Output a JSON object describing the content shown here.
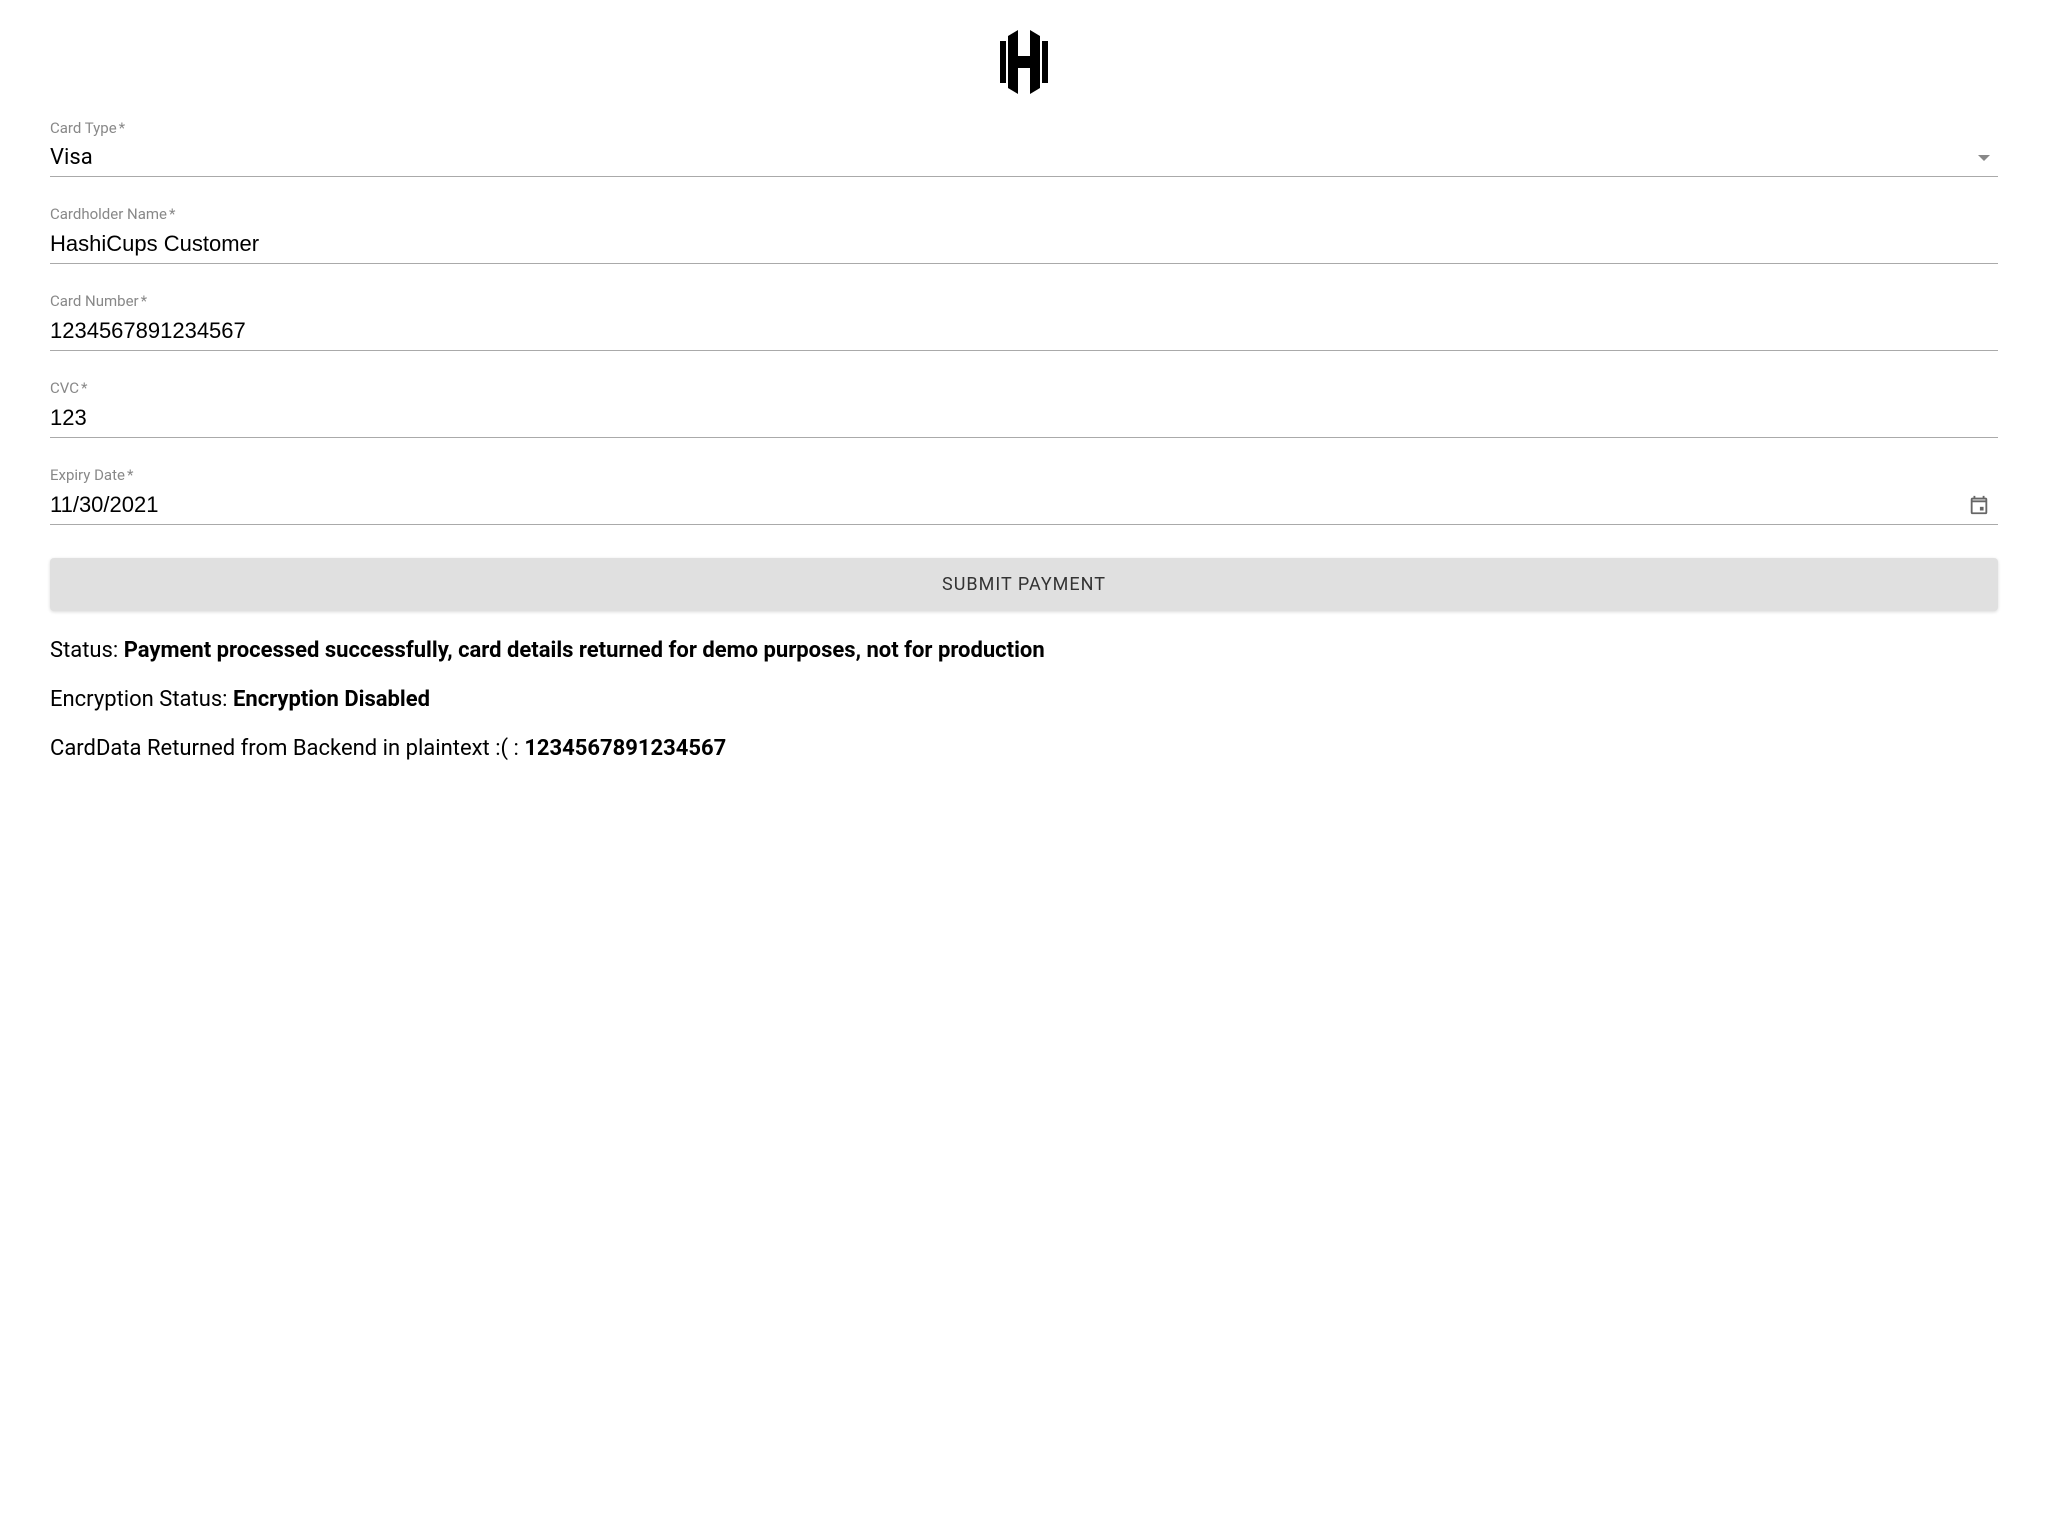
{
  "form": {
    "card_type": {
      "label": "Card Type",
      "required": "*",
      "value": "Visa"
    },
    "cardholder_name": {
      "label": "Cardholder Name",
      "required": "*",
      "value": "HashiCups Customer"
    },
    "card_number": {
      "label": "Card Number",
      "required": "*",
      "value": "1234567891234567"
    },
    "cvc": {
      "label": "CVC",
      "required": "*",
      "value": "123"
    },
    "expiry_date": {
      "label": "Expiry Date",
      "required": "*",
      "value": "11/30/2021"
    },
    "submit_label": "SUBMIT PAYMENT"
  },
  "results": {
    "status_prefix": "Status: ",
    "status_value": "Payment processed successfully, card details returned for demo purposes, not for production",
    "encryption_prefix": "Encryption Status: ",
    "encryption_value": "Encryption Disabled",
    "carddata_prefix": "CardData Returned from Backend in plaintext :( : ",
    "carddata_value": "1234567891234567"
  }
}
